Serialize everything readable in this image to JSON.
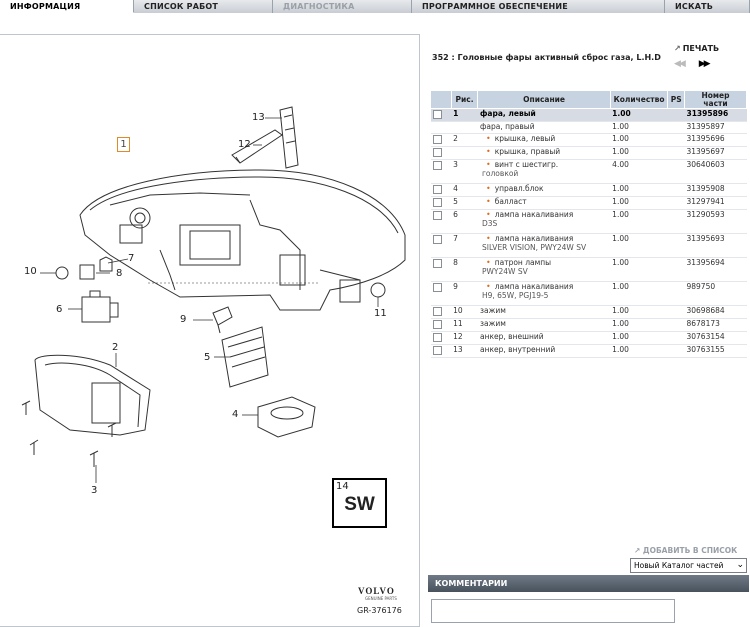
{
  "tabs": [
    {
      "label": "ИНФОРМАЦИЯ"
    },
    {
      "label": "СПИСОК РАБОТ"
    },
    {
      "label": "ДИАГНОСТИКА"
    },
    {
      "label": "ПРОГРАММНОЕ ОБЕСПЕЧЕНИЕ"
    },
    {
      "label": "ИСКАТЬ"
    }
  ],
  "diagram": {
    "selected_marker": "1",
    "callouts": [
      "1",
      "2",
      "3",
      "4",
      "5",
      "6",
      "7",
      "8",
      "9",
      "10",
      "11",
      "12",
      "13"
    ],
    "sw_box": {
      "number": "14",
      "text": "SW"
    },
    "logo": "VOLVO",
    "logo_sub": "GENUINE PARTS",
    "ref": "GR-376176"
  },
  "panel": {
    "title": "352 : Головные фары активный сброс газа, L.H.D",
    "print_label": "ПЕЧАТЬ",
    "prev_icon": "double-left-arrow-icon",
    "next_icon": "double-right-arrow-icon"
  },
  "table": {
    "headers": {
      "pic": "Рис.",
      "desc": "Описание",
      "qty": "Количество",
      "ps": "PS",
      "part_l1": "Номер",
      "part_l2": "части"
    },
    "rows": [
      {
        "pic": "1",
        "desc": "фара, левый",
        "sub": "",
        "qty": "1.00",
        "part": "31395896",
        "bullet": false,
        "checkbox": true
      },
      {
        "pic": "",
        "desc": "фара, правый",
        "sub": "",
        "qty": "1.00",
        "part": "31395897",
        "bullet": false,
        "checkbox": false
      },
      {
        "pic": "2",
        "desc": "крышка, левый",
        "sub": "",
        "qty": "1.00",
        "part": "31395696",
        "bullet": true,
        "checkbox": true
      },
      {
        "pic": "",
        "desc": "крышка, правый",
        "sub": "",
        "qty": "1.00",
        "part": "31395697",
        "bullet": true,
        "checkbox": true
      },
      {
        "pic": "3",
        "desc": "винт с шестигр.",
        "sub": "головкой",
        "qty": "4.00",
        "part": "30640603",
        "bullet": true,
        "checkbox": true
      },
      {
        "pic": "4",
        "desc": "управл.блок",
        "sub": "",
        "qty": "1.00",
        "part": "31395908",
        "bullet": true,
        "checkbox": true
      },
      {
        "pic": "5",
        "desc": "балласт",
        "sub": "",
        "qty": "1.00",
        "part": "31297941",
        "bullet": true,
        "checkbox": true
      },
      {
        "pic": "6",
        "desc": "лампа накаливания",
        "sub": "D3S",
        "qty": "1.00",
        "part": "31290593",
        "bullet": true,
        "checkbox": true
      },
      {
        "pic": "7",
        "desc": "лампа накаливания",
        "sub": "SILVER VISION, PWY24W SV",
        "qty": "1.00",
        "part": "31395693",
        "bullet": true,
        "checkbox": true
      },
      {
        "pic": "8",
        "desc": "патрон лампы",
        "sub": "PWY24W SV",
        "qty": "1.00",
        "part": "31395694",
        "bullet": true,
        "checkbox": true
      },
      {
        "pic": "9",
        "desc": "лампа накаливания",
        "sub": "H9, 65W, PGJ19-5",
        "qty": "1.00",
        "part": "989750",
        "bullet": true,
        "checkbox": true
      },
      {
        "pic": "10",
        "desc": "зажим",
        "sub": "",
        "qty": "1.00",
        "part": "30698684",
        "bullet": false,
        "checkbox": true
      },
      {
        "pic": "11",
        "desc": "зажим",
        "sub": "",
        "qty": "1.00",
        "part": "8678173",
        "bullet": false,
        "checkbox": true
      },
      {
        "pic": "12",
        "desc": "анкер, внешний",
        "sub": "",
        "qty": "1.00",
        "part": "30763154",
        "bullet": false,
        "checkbox": true
      },
      {
        "pic": "13",
        "desc": "анкер, внутренний",
        "sub": "",
        "qty": "1.00",
        "part": "30763155",
        "bullet": false,
        "checkbox": true
      }
    ]
  },
  "add_to_list": "ДОБАВИТЬ В СПИСОК",
  "catalog_select": "Новый Каталог частей",
  "comments_label": "КОММЕНТАРИИ",
  "colors": {
    "bullet": "#e06a1e",
    "header_bg": "#c7d3e0",
    "selected_row": "#d7dce4"
  }
}
